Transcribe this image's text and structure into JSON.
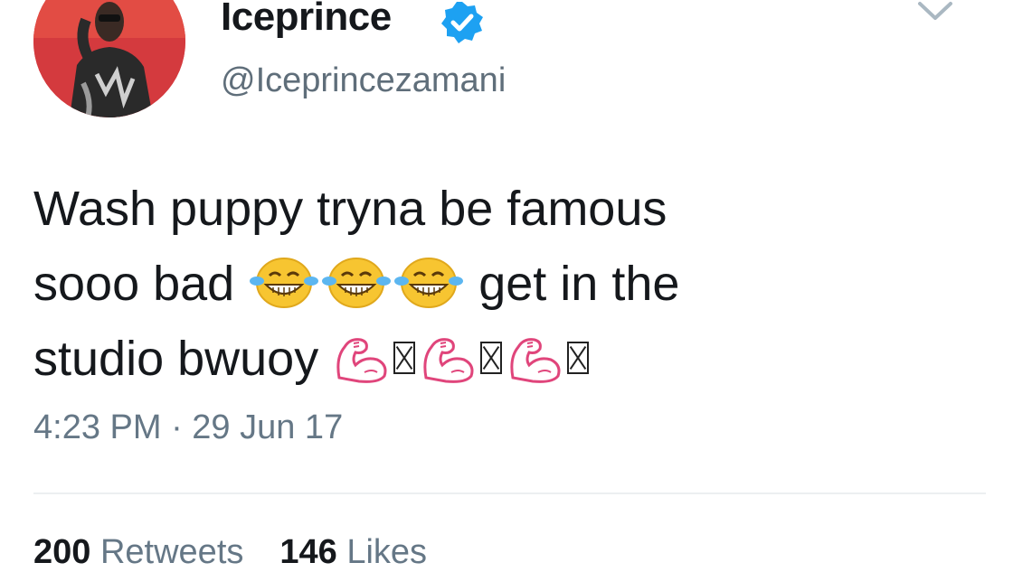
{
  "author": {
    "display_name": "Iceprince",
    "handle": "@Iceprincezamani",
    "verified": true
  },
  "tweet": {
    "text_line1": "Wash puppy tryna be famous",
    "text_line2_before": "sooo bad",
    "text_line2_after": "get in the",
    "text_line3": "studio bwuoy",
    "emojis_line2": [
      "laughing-tears-emoji",
      "laughing-tears-emoji",
      "laughing-tears-emoji"
    ],
    "emojis_line3": [
      "flexed-biceps-emoji",
      "flexed-biceps-emoji",
      "flexed-biceps-emoji"
    ],
    "timestamp": "4:23 PM · 29 Jun 17"
  },
  "stats": {
    "retweets_count": "200",
    "retweets_label": "Retweets",
    "likes_count": "146",
    "likes_label": "Likes"
  },
  "colors": {
    "text": "#15181c",
    "muted": "#657786",
    "verified_blue": "#1da1f2",
    "emoji_yellow": "#f7c531",
    "biceps_outline": "#e0457b"
  }
}
